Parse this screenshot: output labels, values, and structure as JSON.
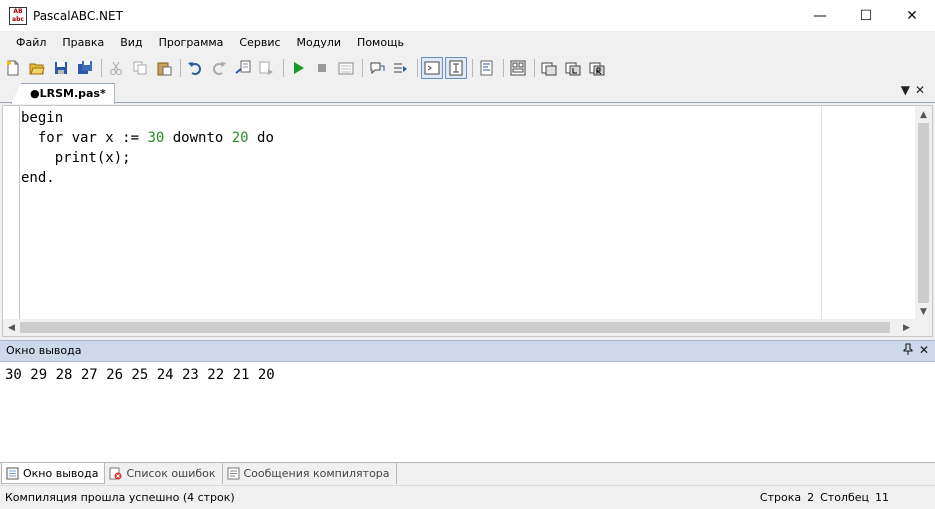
{
  "window": {
    "title": "PascalABC.NET",
    "icon": "pascalabc-app-icon"
  },
  "window_controls": {
    "minimize": "—",
    "maximize": "☐",
    "close": "✕"
  },
  "menu": [
    "Файл",
    "Правка",
    "Вид",
    "Программа",
    "Сервис",
    "Модули",
    "Помощь"
  ],
  "toolbar": {
    "icons": [
      "new-file-icon",
      "open-icon",
      "save-icon",
      "save-all-icon",
      "cut-icon",
      "copy-icon",
      "paste-icon",
      "undo-icon",
      "redo-icon",
      "find-icon",
      "replace-icon",
      "run-icon",
      "stop-icon",
      "debug-icon",
      "step-over-icon",
      "step-into-icon",
      "output-window-icon",
      "input-window-icon",
      "format-code-icon",
      "form-designer-icon",
      "compile-icon",
      "compile-debug-icon",
      "compile-release-icon"
    ]
  },
  "editor": {
    "tab_label": "●LRSM.pas*",
    "lines": [
      {
        "segments": [
          {
            "t": "begin",
            "c": ""
          }
        ]
      },
      {
        "segments": [
          {
            "t": "  for var x := ",
            "c": ""
          },
          {
            "t": "30",
            "c": "num"
          },
          {
            "t": " downto ",
            "c": ""
          },
          {
            "t": "20",
            "c": "num"
          },
          {
            "t": " do",
            "c": ""
          }
        ]
      },
      {
        "segments": [
          {
            "t": "    print(x);",
            "c": ""
          }
        ]
      },
      {
        "segments": [
          {
            "t": "end.",
            "c": ""
          }
        ]
      }
    ]
  },
  "output_panel": {
    "title": "Окно вывода",
    "pin": "📌",
    "close": "✕",
    "text": "30 29 28 27 26 25 24 23 22 21 20"
  },
  "bottom_tabs": [
    {
      "label": "Окно вывода",
      "icon": "output-window-icon",
      "active": true
    },
    {
      "label": "Список ошибок",
      "icon": "error-list-icon",
      "active": false
    },
    {
      "label": "Сообщения компилятора",
      "icon": "compiler-messages-icon",
      "active": false
    }
  ],
  "status": {
    "message": "Компиляция прошла успешно (4 строк)",
    "row_label": "Строка",
    "row": "2",
    "col_label": "Столбец",
    "col": "11"
  },
  "colors": {
    "number": "#2a8a2a",
    "panel_header": "#cdd9ea",
    "accent": "#6d90c0"
  }
}
